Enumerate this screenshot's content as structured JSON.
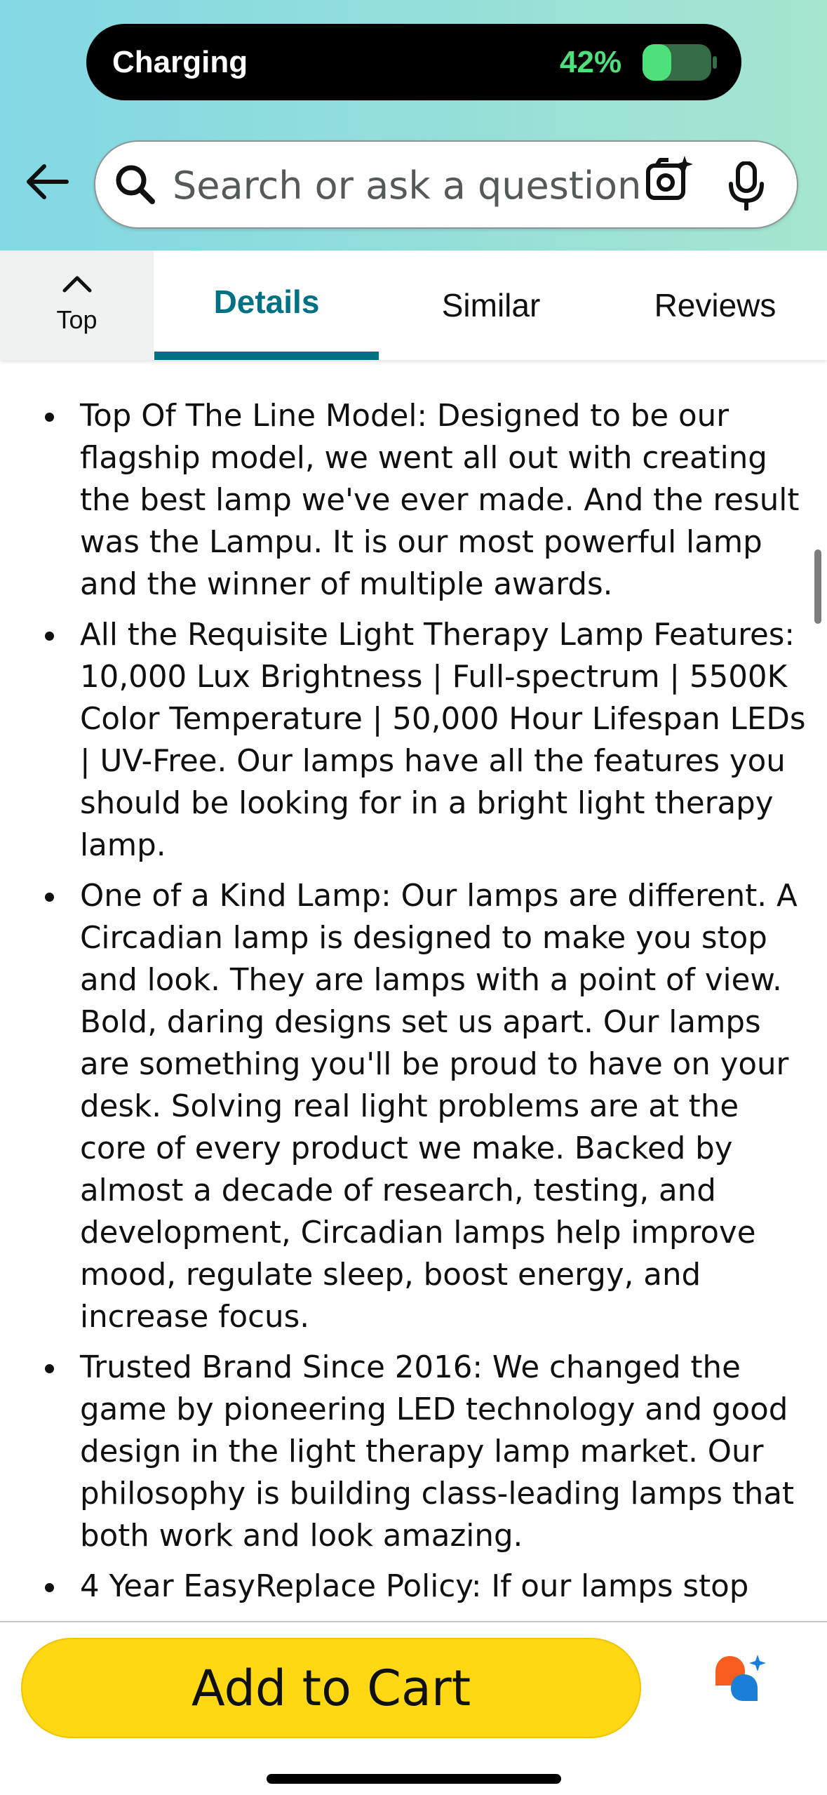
{
  "status_bar": {
    "label": "Charging",
    "battery_percent_text": "42%",
    "battery_level": 0.42,
    "battery_color": "#4ee07a"
  },
  "header": {
    "back_icon": "arrow-left-icon",
    "search": {
      "placeholder": "Search or ask a question",
      "value": ""
    },
    "camera_icon": "camera-sparkle-icon",
    "mic_icon": "microphone-icon"
  },
  "tabs": {
    "top_label": "Top",
    "items": [
      {
        "label": "Details",
        "active": true
      },
      {
        "label": "Similar",
        "active": false
      },
      {
        "label": "Reviews",
        "active": false
      }
    ],
    "accent_color": "#007185"
  },
  "content": {
    "bullets": [
      "Top Of The Line Model: Designed to be our flagship model, we went all out with creating the best lamp we've ever made. And the result was the Lampu. It is our most powerful lamp and the winner of multiple awards.",
      "All the Requisite Light Therapy Lamp Features: 10,000 Lux Brightness | Full-spectrum | 5500K Color Temperature | 50,000 Hour Lifespan LEDs | UV-Free. Our lamps have all the features you should be looking for in a bright light therapy lamp.",
      "One of a Kind Lamp: Our lamps are different. A Circadian lamp is designed to make you stop and look. They are lamps with a point of view. Bold, daring designs set us apart. Our lamps are something you'll be proud to have on your desk. Solving real light problems are at the core of every product we make. Backed by almost a decade of research, testing, and development, Circadian lamps help improve mood, regulate sleep, boost energy, and increase focus.",
      "Trusted Brand Since 2016: We changed the game by pioneering LED technology and good design in the light therapy lamp market. Our philosophy is building class-leading lamps that both work and look amazing.",
      "4 Year EasyReplace Policy: If our lamps stop"
    ]
  },
  "bottom_bar": {
    "add_to_cart_label": "Add to Cart",
    "add_to_cart_color": "#ffd814",
    "assistant_icon": "rufus-assistant-icon"
  }
}
